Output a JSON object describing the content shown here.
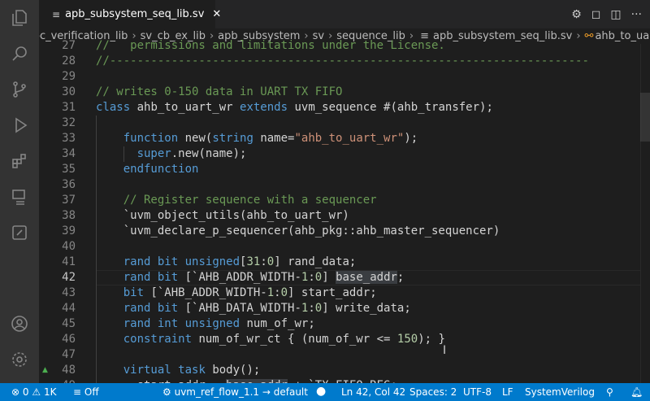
{
  "activity_bar": {
    "items": [
      {
        "name": "explorer-icon"
      },
      {
        "name": "search-icon"
      },
      {
        "name": "source-control-icon"
      },
      {
        "name": "run-debug-icon"
      },
      {
        "name": "extensions-icon"
      },
      {
        "name": "remote-explorer-icon"
      },
      {
        "name": "notes-icon"
      }
    ],
    "bottom": [
      {
        "name": "account-icon"
      },
      {
        "name": "settings-gear-icon"
      }
    ]
  },
  "tab": {
    "label": "apb_subsystem_seq_lib.sv",
    "close": "✕"
  },
  "breadcrumb": [
    "oc_verification_lib",
    "sv_cb_ex_lib",
    "apb_subsystem",
    "sv",
    "sequence_lib",
    "apb_subsystem_seq_lib.sv",
    "ahb_to_uart_wr"
  ],
  "editor": {
    "current_line": 42,
    "lines": [
      {
        "n": "27",
        "t": [
          [
            "cm",
            "//   permissions and limitations under the License."
          ]
        ]
      },
      {
        "n": "28",
        "t": [
          [
            "cm",
            "//----------------------------------------------------------------------"
          ]
        ]
      },
      {
        "n": "29",
        "t": []
      },
      {
        "n": "30",
        "t": [
          [
            "cm",
            "// writes 0-150 data in UART TX FIFO"
          ]
        ]
      },
      {
        "n": "31",
        "t": [
          [
            "kw",
            "class"
          ],
          [
            "tx",
            " ahb_to_uart_wr "
          ],
          [
            "kw",
            "extends"
          ],
          [
            "tx",
            " uvm_sequence #(ahb_transfer);"
          ]
        ]
      },
      {
        "n": "32",
        "t": []
      },
      {
        "n": "33",
        "t": [
          [
            "tx",
            "    "
          ],
          [
            "kw",
            "function"
          ],
          [
            "tx",
            " new("
          ],
          [
            "kw",
            "string"
          ],
          [
            "tx",
            " name="
          ],
          [
            "st",
            "\"ahb_to_uart_wr\""
          ],
          [
            "tx",
            ");"
          ]
        ]
      },
      {
        "n": "34",
        "t": [
          [
            "tx",
            "      "
          ],
          [
            "kw",
            "super"
          ],
          [
            "tx",
            ".new(name);"
          ]
        ]
      },
      {
        "n": "35",
        "t": [
          [
            "tx",
            "    "
          ],
          [
            "kw",
            "endfunction"
          ]
        ]
      },
      {
        "n": "36",
        "t": []
      },
      {
        "n": "37",
        "t": [
          [
            "tx",
            "    "
          ],
          [
            "cm",
            "// Register sequence with a sequencer"
          ]
        ]
      },
      {
        "n": "38",
        "t": [
          [
            "tx",
            "    `uvm_object_utils(ahb_to_uart_wr)"
          ]
        ]
      },
      {
        "n": "39",
        "t": [
          [
            "tx",
            "    `uvm_declare_p_sequencer(ahb_pkg::ahb_master_sequencer)"
          ]
        ]
      },
      {
        "n": "40",
        "t": []
      },
      {
        "n": "41",
        "t": [
          [
            "tx",
            "    "
          ],
          [
            "kw",
            "rand"
          ],
          [
            "tx",
            " "
          ],
          [
            "kw",
            "bit"
          ],
          [
            "tx",
            " "
          ],
          [
            "kw",
            "unsigned"
          ],
          [
            "tx",
            "["
          ],
          [
            "nu",
            "31"
          ],
          [
            "tx",
            ":"
          ],
          [
            "nu",
            "0"
          ],
          [
            "tx",
            "] rand_data;"
          ]
        ]
      },
      {
        "n": "42",
        "t": [
          [
            "tx",
            "    "
          ],
          [
            "kw",
            "rand"
          ],
          [
            "tx",
            " "
          ],
          [
            "kw",
            "bit"
          ],
          [
            "tx",
            " [`AHB_ADDR_WIDTH-"
          ],
          [
            "nu",
            "1"
          ],
          [
            "tx",
            ":"
          ],
          [
            "nu",
            "0"
          ],
          [
            "tx",
            "] "
          ],
          [
            "hl",
            "base_addr"
          ],
          [
            "tx",
            ";"
          ]
        ]
      },
      {
        "n": "43",
        "t": [
          [
            "tx",
            "    "
          ],
          [
            "kw",
            "bit"
          ],
          [
            "tx",
            " [`AHB_ADDR_WIDTH-"
          ],
          [
            "nu",
            "1"
          ],
          [
            "tx",
            ":"
          ],
          [
            "nu",
            "0"
          ],
          [
            "tx",
            "] start_addr;"
          ]
        ]
      },
      {
        "n": "44",
        "t": [
          [
            "tx",
            "    "
          ],
          [
            "kw",
            "rand"
          ],
          [
            "tx",
            " "
          ],
          [
            "kw",
            "bit"
          ],
          [
            "tx",
            " [`AHB_DATA_WIDTH-"
          ],
          [
            "nu",
            "1"
          ],
          [
            "tx",
            ":"
          ],
          [
            "nu",
            "0"
          ],
          [
            "tx",
            "] write_data;"
          ]
        ]
      },
      {
        "n": "45",
        "t": [
          [
            "tx",
            "    "
          ],
          [
            "kw",
            "rand"
          ],
          [
            "tx",
            " "
          ],
          [
            "kw",
            "int"
          ],
          [
            "tx",
            " "
          ],
          [
            "kw",
            "unsigned"
          ],
          [
            "tx",
            " num_of_wr;"
          ]
        ]
      },
      {
        "n": "46",
        "t": [
          [
            "tx",
            "    "
          ],
          [
            "kw",
            "constraint"
          ],
          [
            "tx",
            " num_of_wr_ct { (num_of_wr <= "
          ],
          [
            "nu",
            "150"
          ],
          [
            "tx",
            "); }"
          ]
        ]
      },
      {
        "n": "47",
        "t": []
      },
      {
        "n": "48",
        "t": [
          [
            "tx",
            "    "
          ],
          [
            "kw",
            "virtual"
          ],
          [
            "tx",
            " "
          ],
          [
            "kw",
            "task"
          ],
          [
            "tx",
            " body();"
          ]
        ]
      },
      {
        "n": "49",
        "t": [
          [
            "tx",
            "      start_addr = "
          ],
          [
            "hl",
            "base_addr"
          ],
          [
            "tx",
            " + `TX_FIFO_REG;"
          ]
        ]
      }
    ]
  },
  "status": {
    "errors": "0",
    "warnings": "1K",
    "filter": "Off",
    "project": "uvm_ref_flow_1.1 → default",
    "position": "Ln 42, Col 42",
    "spaces": "Spaces: 2",
    "encoding": "UTF-8",
    "eol": "LF",
    "language": "SystemVerilog"
  },
  "colors": {
    "status_bar": "#007acc",
    "keyword": "#569cd6",
    "comment": "#6a9955",
    "string": "#ce9178",
    "number": "#b5cea8"
  }
}
